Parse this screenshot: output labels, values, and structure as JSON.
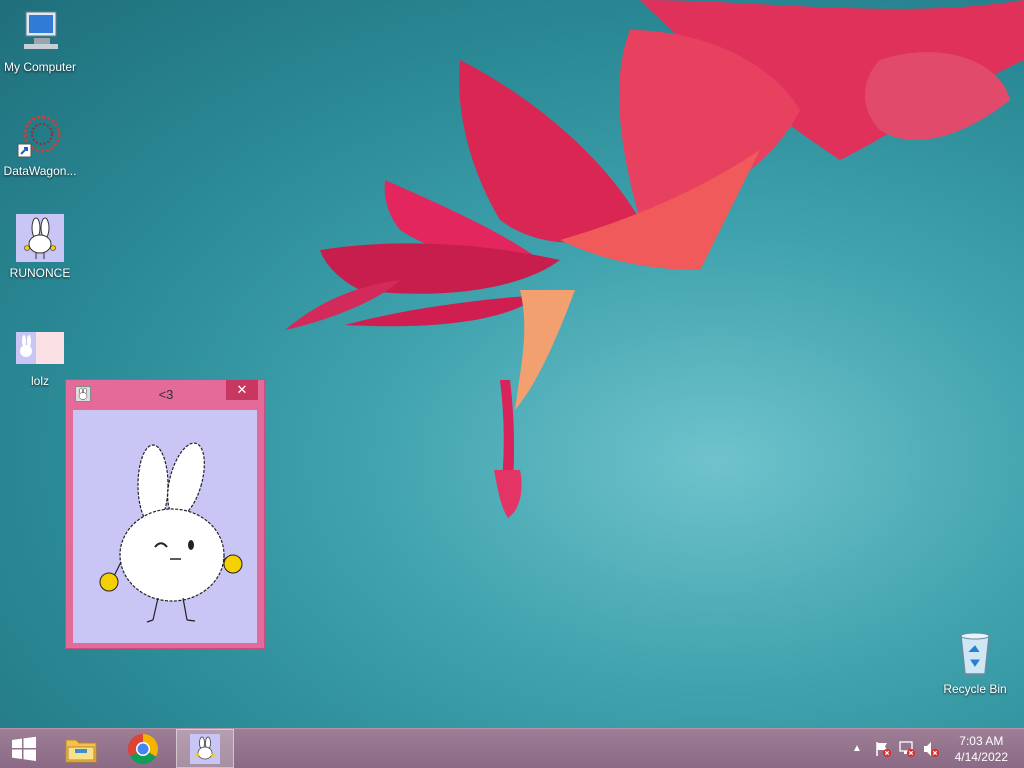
{
  "desktop": {
    "icons": [
      {
        "label": "My Computer"
      },
      {
        "label": "DataWagon..."
      },
      {
        "label": "RUNONCE"
      },
      {
        "label": "lolz"
      },
      {
        "label": "Recycle Bin"
      }
    ]
  },
  "app_window": {
    "title": "<3",
    "close_glyph": "✕"
  },
  "taskbar": {
    "items": [
      {
        "icon": "windows-start-icon"
      },
      {
        "icon": "file-explorer-icon"
      },
      {
        "icon": "chrome-icon"
      },
      {
        "icon": "bunny-app-icon"
      }
    ],
    "tray": {
      "time": "7:03 AM",
      "date": "4/14/2022"
    }
  },
  "colors": {
    "taskbar": "#8b6a85",
    "window_frame": "#e46a9a",
    "window_client": "#c9c5f5",
    "close_button": "#c7375f"
  }
}
